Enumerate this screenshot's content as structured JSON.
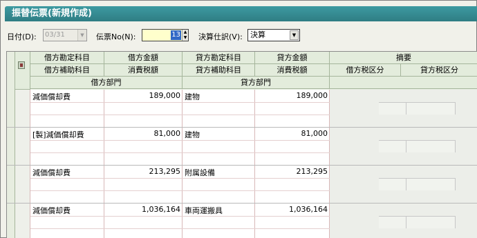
{
  "window": {
    "title": "振替伝票(新規作成)"
  },
  "toolbar": {
    "date_label": "日付(D):",
    "date_value": "03/31",
    "voucher_no_label": "伝票No(N):",
    "voucher_no_value": "13",
    "closing_label": "決算仕訳(V):",
    "closing_value": "決算"
  },
  "columns": {
    "row1": [
      "借方勘定科目",
      "借方金額",
      "貸方勘定科目",
      "貸方金額",
      "摘要"
    ],
    "row2": [
      "借方補助科目",
      "消費税額",
      "貸方補助科目",
      "消費税額",
      "借方税区分",
      "貸方税区分"
    ],
    "row3": [
      "借方部門",
      "貸方部門"
    ]
  },
  "entries": [
    {
      "debit_account": "減価償却費",
      "debit_amount": "189,000",
      "credit_account": "建物",
      "credit_amount": "189,000"
    },
    {
      "debit_account": "[製]減価償却費",
      "debit_amount": "81,000",
      "credit_account": "建物",
      "credit_amount": "81,000"
    },
    {
      "debit_account": "減価償却費",
      "debit_amount": "213,295",
      "credit_account": "附属設備",
      "credit_amount": "213,295"
    },
    {
      "debit_account": "減価償却費",
      "debit_amount": "1,036,164",
      "credit_account": "車両運搬具",
      "credit_amount": "1,036,164"
    }
  ],
  "icons": {
    "memo": "memo-icon",
    "dropdown": "chevron-down-icon",
    "spinner": "spinner-icon"
  },
  "colors": {
    "title_bar": "#2f7d84",
    "header_bg": "#e3ecdc",
    "input_highlight": "#ffffcc",
    "selection": "#3168c6"
  }
}
